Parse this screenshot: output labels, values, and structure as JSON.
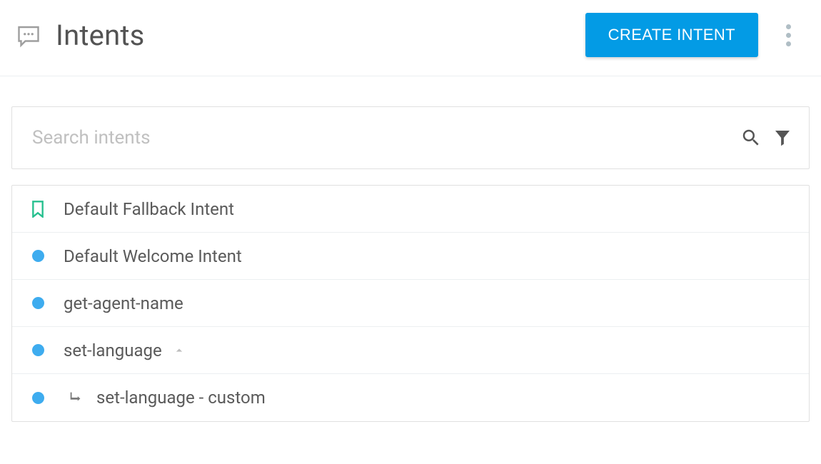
{
  "header": {
    "title": "Intents",
    "create_label": "CREATE INTENT"
  },
  "search": {
    "placeholder": "Search intents"
  },
  "intents": [
    {
      "icon": "bookmark",
      "label": "Default Fallback Intent",
      "indent": 0,
      "expandable": false
    },
    {
      "icon": "dot",
      "label": "Default Welcome Intent",
      "indent": 0,
      "expandable": false
    },
    {
      "icon": "dot",
      "label": "get-agent-name",
      "indent": 0,
      "expandable": false
    },
    {
      "icon": "dot",
      "label": "set-language",
      "indent": 0,
      "expandable": true,
      "expanded": true
    },
    {
      "icon": "dot",
      "label": "set-language - custom",
      "indent": 1,
      "expandable": false
    }
  ]
}
